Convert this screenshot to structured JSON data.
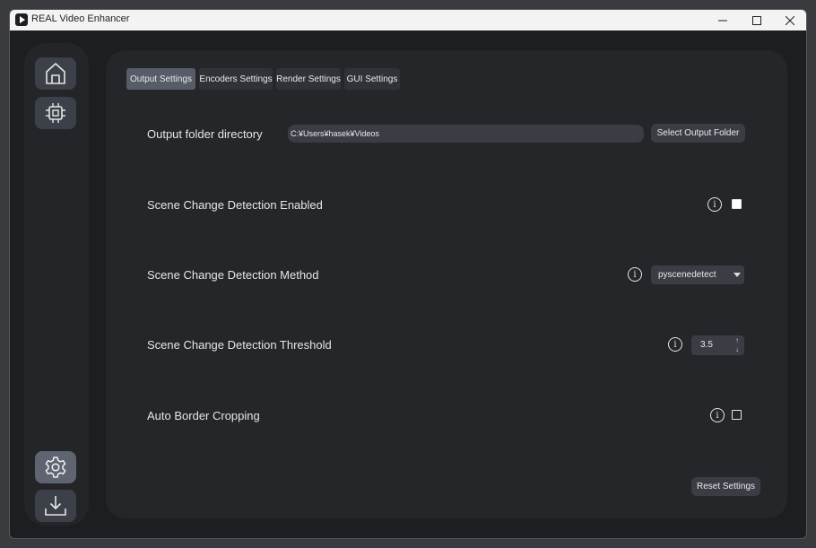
{
  "window": {
    "title": "REAL Video Enhancer"
  },
  "sidebar": {
    "items": [
      {
        "icon": "home-icon",
        "label": "Home"
      },
      {
        "icon": "chip-icon",
        "label": "Processing"
      },
      {
        "icon": "gear-icon",
        "label": "Settings",
        "active": true
      },
      {
        "icon": "download-icon",
        "label": "Download"
      }
    ]
  },
  "tabs": [
    {
      "label": "Output Settings",
      "active": true
    },
    {
      "label": "Encoders Settings"
    },
    {
      "label": "Render Settings"
    },
    {
      "label": "GUI Settings"
    }
  ],
  "settings": {
    "output_folder": {
      "label": "Output folder directory",
      "value": "C:¥Users¥hasek¥Videos",
      "button": "Select Output Folder"
    },
    "scene_change_enabled": {
      "label": "Scene Change Detection Enabled",
      "checked": true
    },
    "scene_change_method": {
      "label": "Scene Change Detection Method",
      "value": "pyscenedetect"
    },
    "scene_change_threshold": {
      "label": "Scene Change Detection Threshold",
      "value": "3.5"
    },
    "auto_border_cropping": {
      "label": "Auto Border Cropping",
      "checked": false
    }
  },
  "info_glyph": "i",
  "reset_button": "Reset Settings",
  "colors": {
    "background": "#1c1e21",
    "panel": "#24262a",
    "active_tab": "#565d68",
    "control": "#3a3d44",
    "text": "#e6e6e7"
  }
}
